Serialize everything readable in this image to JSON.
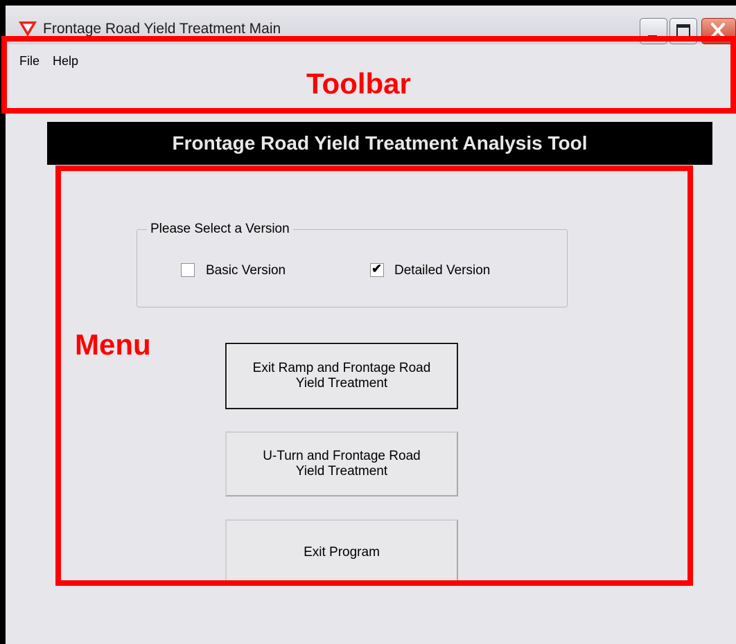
{
  "window": {
    "title": "Frontage Road Yield Treatment Main"
  },
  "menubar": {
    "items": [
      "File",
      "Help"
    ]
  },
  "annotations": {
    "toolbar_label": "Toolbar",
    "menu_label": "Menu",
    "color": "#ff0000"
  },
  "banner": {
    "text": "Frontage Road Yield Treatment Analysis Tool"
  },
  "version_group": {
    "legend": "Please Select a Version",
    "options": [
      {
        "label": "Basic Version",
        "checked": false
      },
      {
        "label": "Detailed Version",
        "checked": true
      }
    ]
  },
  "buttons": {
    "exit_ramp": "Exit Ramp and Frontage Road\nYield Treatment",
    "u_turn": "U-Turn and Frontage Road\nYield Treatment",
    "exit_program": "Exit Program"
  },
  "icons": {
    "app": "yield-sign-icon",
    "minimize": "minimize-icon",
    "maximize": "maximize-icon",
    "close": "close-icon",
    "checkmark": "checkmark-icon"
  }
}
